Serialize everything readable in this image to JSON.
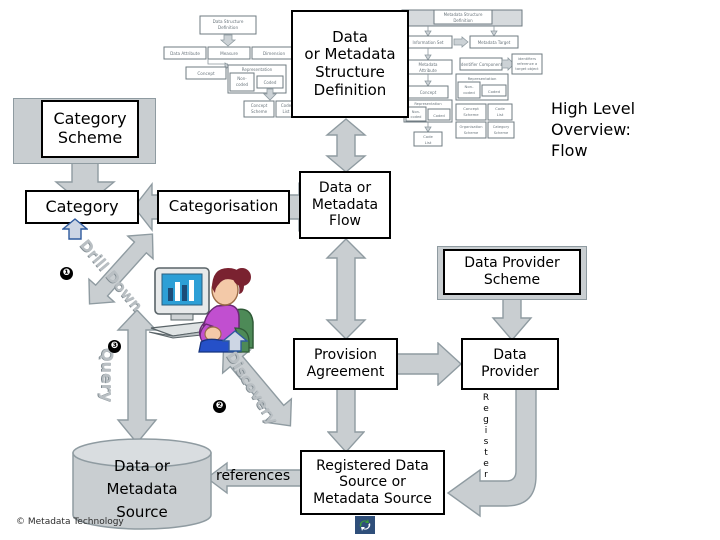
{
  "title": "High Level Overview: Flow",
  "overview_label": "High Level\nOverview:\nFlow",
  "overview_lines": [
    "High Level",
    "Overview:",
    "Flow"
  ],
  "nodes": {
    "structure_definition": "Data\nor Metadata\nStructure\nDefinition",
    "structure_definition_lines": [
      "Data",
      "or Metadata",
      "Structure",
      "Definition"
    ],
    "category_scheme": "Category\nScheme",
    "category_scheme_lines": [
      "Category",
      "Scheme"
    ],
    "category": "Category",
    "categorisation": "Categorisation",
    "data_flow": "Data or\nMetadata\nFlow",
    "data_flow_lines": [
      "Data or",
      "Metadata",
      "Flow"
    ],
    "data_provider_scheme": "Data Provider\nScheme",
    "data_provider_scheme_lines": [
      "Data Provider",
      "Scheme"
    ],
    "provision_agreement": "Provision\nAgreement",
    "provision_agreement_lines": [
      "Provision",
      "Agreement"
    ],
    "data_provider": "Data\nProvider",
    "data_provider_lines": [
      "Data",
      "Provider"
    ],
    "registered_source": "Registered Data\nSource or\nMetadata Source",
    "registered_source_lines": [
      "Registered Data",
      "Source or",
      "Metadata Source"
    ],
    "data_source": "Data or\nMetadata\nSource",
    "data_source_lines": [
      "Data or",
      "Metadata",
      "Source"
    ]
  },
  "edge_labels": {
    "references": "references",
    "register": "Register",
    "register_letters": [
      "R",
      "e",
      "g",
      "i",
      "s",
      "t",
      "e",
      "r"
    ],
    "drill_down": "Drill Down",
    "query": "Query",
    "discovery": "Discovery"
  },
  "markers": {
    "one": "❶",
    "two": "❷",
    "three": "❸"
  },
  "footer": {
    "copyright": "© Metadata Technology"
  },
  "thumbnails": {
    "left": {
      "name": "data-structure-definition-thumbnail",
      "caption": "Data Structure Definition",
      "boxes": [
        "Data Structure Definition",
        "Data Attribute",
        "Measure",
        "Dimension",
        "Concept",
        "Representation",
        "Non-coded",
        "Coded",
        "Concept Scheme",
        "Code List"
      ]
    },
    "right": {
      "name": "metadata-structure-definition-thumbnail",
      "caption": "Metadata Structure Definition",
      "boxes": [
        "Metadata Structure Definition",
        "Information Set",
        "Metadata Target",
        "Metadata Attribute",
        "Identifier Component",
        "Identifiers reference a target object",
        "Concept",
        "Representation",
        "Non-coded",
        "Coded",
        "Concept Scheme",
        "Code List",
        "Organisation Scheme",
        "Category Scheme"
      ]
    }
  },
  "colors": {
    "arrow_fill": "#c9ced1",
    "arrow_stroke": "#8f9ba1",
    "box_border": "#000000",
    "box_fill": "#ffffff",
    "text": "#000000",
    "rot_label": "#b9bfc3"
  },
  "icons": {
    "recycle": "recycle-icon",
    "person_computer": "person-at-computer-clipart"
  }
}
